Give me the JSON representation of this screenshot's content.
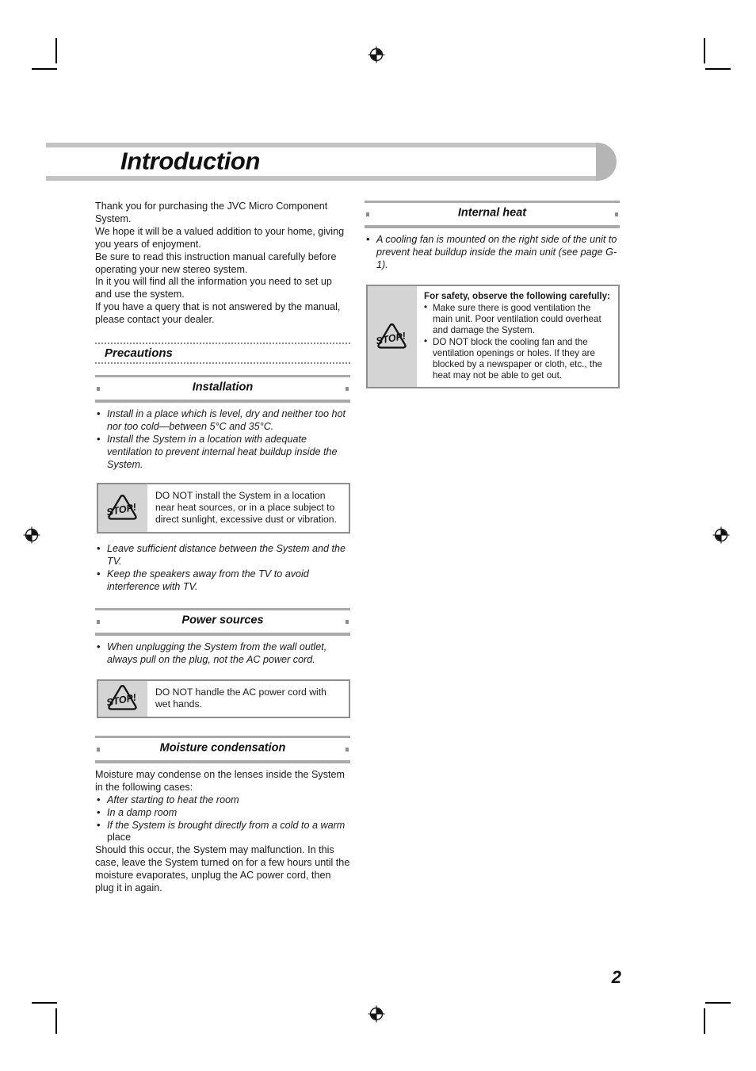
{
  "page": {
    "title": "Introduction",
    "number": "2"
  },
  "left_column": {
    "lead_paragraph": "Thank you for purchasing the JVC Micro Component System.\nWe hope it will be a valued addition to your home, giving you years of enjoyment.\nBe sure to read this instruction manual carefully before operating your new stereo system.\nIn it you will find all the information you need to set up and use the system.\nIf you have a query that is not answered by the manual, please contact your dealer.",
    "precautions_label": "Precautions",
    "sections": [
      {
        "heading": "Installation",
        "bullets": [
          "Install in a place which is level, dry and neither too hot nor too cold—between 5°C and 35°C.",
          "Install the System in a location with adequate ventilation to prevent internal heat buildup inside the System."
        ],
        "caution": {
          "icon": "stop-triangle-icon",
          "text": "DO NOT install the System in a location near heat sources, or in a place subject to direct sunlight, excessive dust or vibration."
        },
        "bullets_after": [
          "Leave sufficient distance between the System and the TV.",
          "Keep the speakers away from the TV to avoid interference with TV."
        ]
      },
      {
        "heading": "Power sources",
        "bullets": [
          "When unplugging the System from the wall outlet, always pull on the plug, not the AC power cord."
        ],
        "caution": {
          "icon": "stop-triangle-icon",
          "text": "DO NOT handle the AC power cord with wet hands."
        }
      },
      {
        "heading": "Moisture condensation",
        "intro": "Moisture may condense on the lenses inside the System in the following cases:",
        "bullets": [
          "After starting to heat the room",
          "In a damp room"
        ],
        "bullet_mixed_italic": "If the System is brought directly from a cold to a warm",
        "bullet_mixed_roman": " place",
        "outro": "Should this occur, the System may malfunction. In this case, leave the System turned on for a few hours until the moisture evaporates, unplug the AC power cord, then plug it in again."
      }
    ]
  },
  "right_column": {
    "sections": [
      {
        "heading": "Internal heat",
        "bullets": [
          "A cooling fan is mounted on the right side of the unit to prevent heat buildup inside the main unit (see page G-1)."
        ],
        "caution": {
          "icon": "stop-triangle-icon",
          "headline": "For safety, observe the following carefully:",
          "bullets": [
            "Make sure there is good ventilation the main unit. Poor ventilation could overheat and damage the System.",
            "DO NOT block the cooling fan and the ventilation openings or holes. If they are blocked by a newspaper or cloth, etc., the heat may not be able to get out."
          ]
        }
      }
    ]
  },
  "print_marks": {
    "registration_icon": "registration-crosshair-icon",
    "crop_icon": "crop-mark-icon"
  },
  "colors": {
    "banner_bar": "#c3c3c3",
    "banner_cap": "#b5b5b5",
    "section_rule": "#a9a9a9",
    "caution_icon_panel": "#d4d4d4",
    "text": "#1a1a1a"
  }
}
